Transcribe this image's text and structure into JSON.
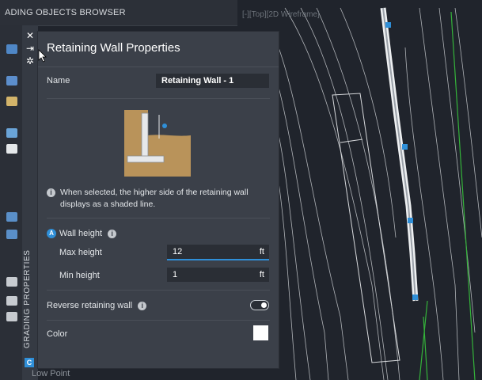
{
  "browser": {
    "title": "ADING OBJECTS BROWSER",
    "vertical_label": "GRADING PROPERTIES",
    "badge": "C",
    "bottom_text": "Low Point"
  },
  "viewport": {
    "viewcube_label": "[-][Top][2D Wireframe]"
  },
  "panel": {
    "title": "Retaining Wall Properties",
    "name_label": "Name",
    "name_value": "Retaining Wall - 1",
    "hint": "When selected, the higher side of the retaining wall displays as a shaded line.",
    "wall_height_badge": "A",
    "wall_height_label": "Wall height",
    "max_height_label": "Max height",
    "max_height_value": "12",
    "min_height_label": "Min height",
    "min_height_value": "1",
    "unit": "ft",
    "reverse_label": "Reverse retaining wall",
    "reverse_enabled": false,
    "color_label": "Color",
    "color_value": "#ffffff"
  },
  "icons": {
    "close": "close-icon",
    "pin": "pin-icon",
    "settings": "gear-icon",
    "info": "info-icon"
  }
}
